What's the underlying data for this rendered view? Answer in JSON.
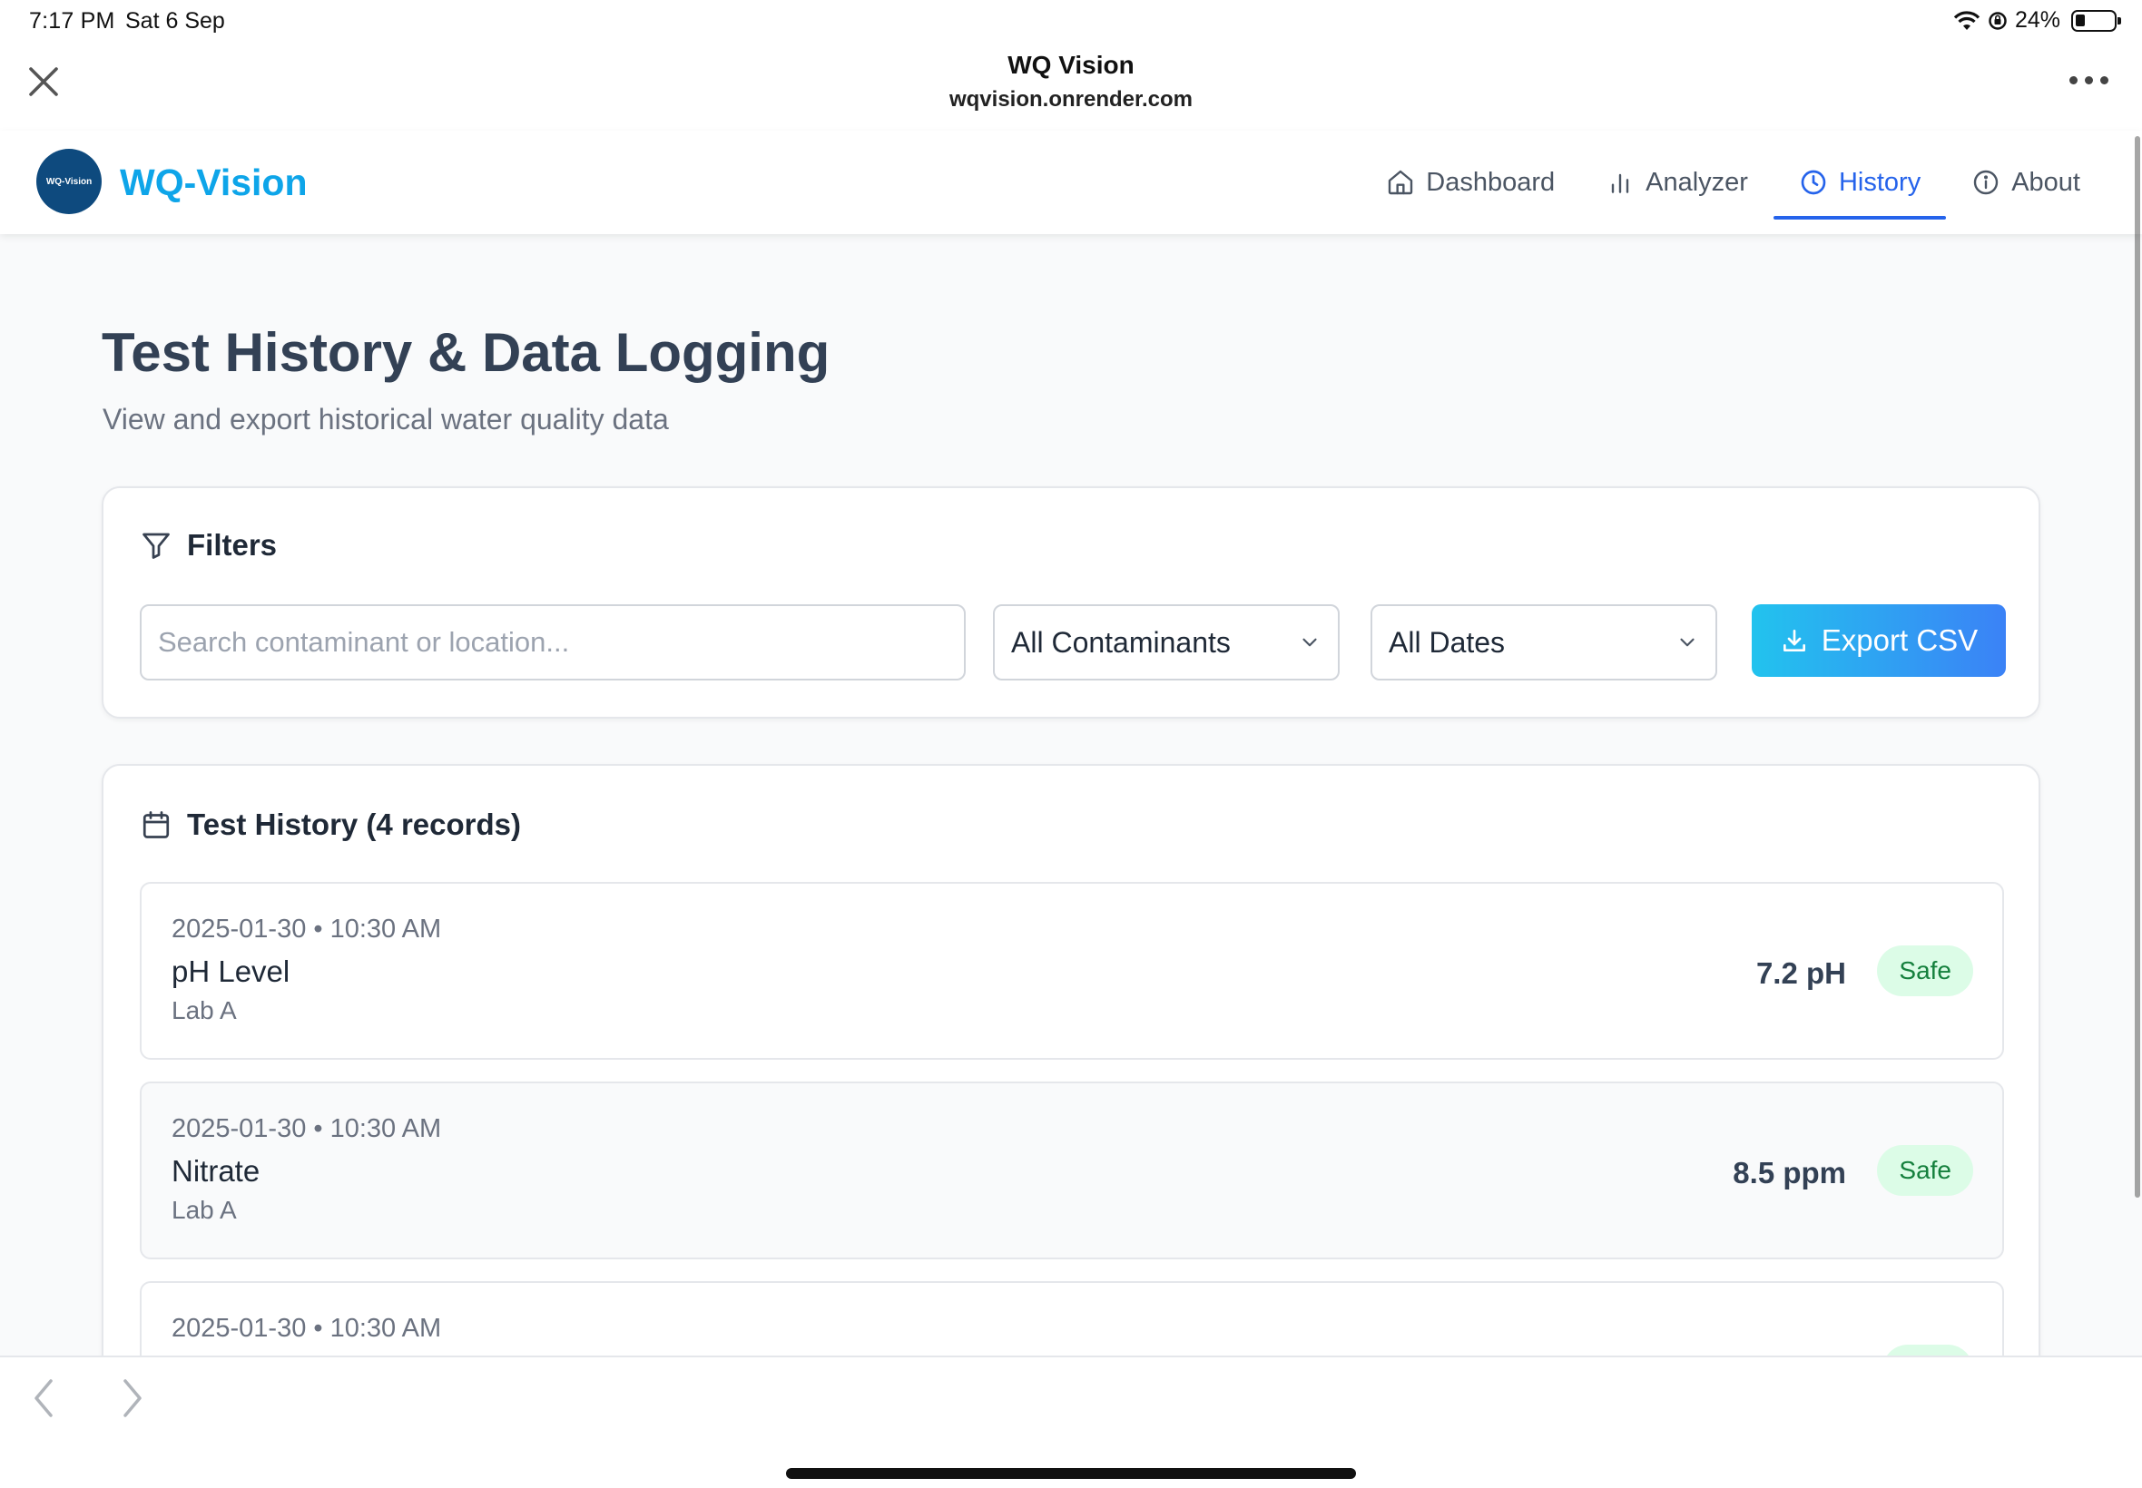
{
  "status_bar": {
    "time": "7:17 PM",
    "date": "Sat 6 Sep",
    "battery": "24%"
  },
  "browser": {
    "title": "WQ Vision",
    "url": "wqvision.onrender.com"
  },
  "app": {
    "brand": "WQ-Vision",
    "logo_text": "WQ-Vision",
    "nav": [
      {
        "label": "Dashboard",
        "icon": "home-icon"
      },
      {
        "label": "Analyzer",
        "icon": "bar-chart-icon"
      },
      {
        "label": "History",
        "icon": "clock-icon",
        "active": true
      },
      {
        "label": "About",
        "icon": "info-icon"
      }
    ]
  },
  "page": {
    "title": "Test History & Data Logging",
    "subtitle": "View and export historical water quality data"
  },
  "filters": {
    "heading": "Filters",
    "search_value": "",
    "search_placeholder": "Search contaminant or location...",
    "contaminant_select": "All Contaminants",
    "date_select": "All Dates",
    "export_label": "Export CSV"
  },
  "history": {
    "heading": "Test History (4 records)",
    "records": [
      {
        "datetime": "2025-01-30 • 10:30 AM",
        "name": "pH Level",
        "location": "Lab A",
        "value": "7.2 pH",
        "status": "Safe"
      },
      {
        "datetime": "2025-01-30 • 10:30 AM",
        "name": "Nitrate",
        "location": "Lab A",
        "value": "8.5 ppm",
        "status": "Safe"
      },
      {
        "datetime": "2025-01-30 • 10:30 AM",
        "name": "",
        "location": "",
        "value": "",
        "status": ""
      }
    ]
  },
  "colors": {
    "accent": "#2563eb",
    "brand": "#0ea5e9",
    "safe_bg": "#dcfce7",
    "safe_text": "#15803d"
  }
}
